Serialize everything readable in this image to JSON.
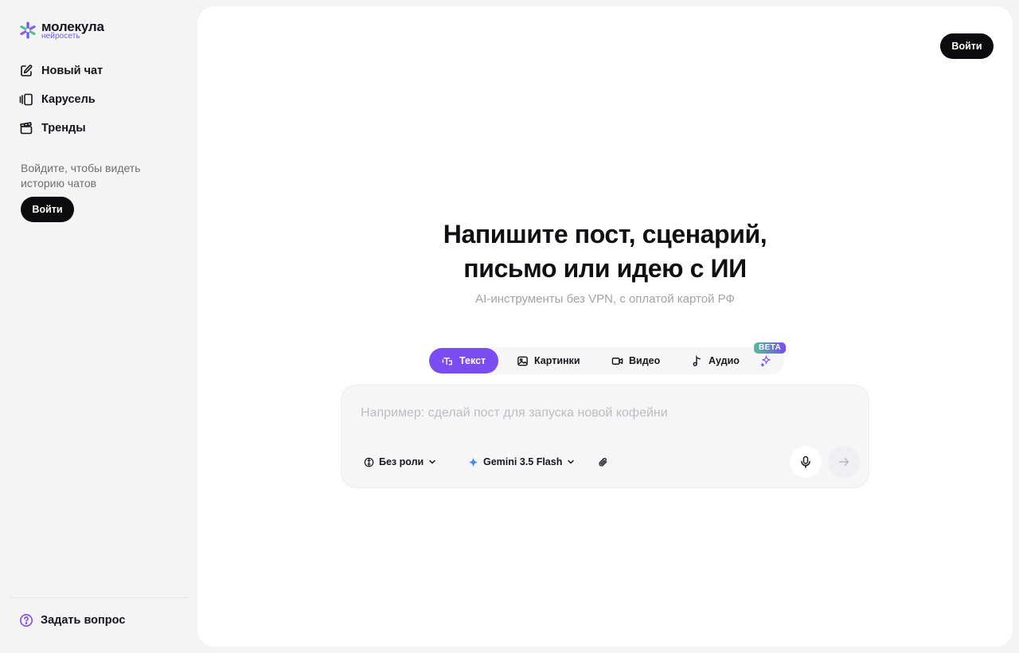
{
  "brand": {
    "name": "молекула",
    "sub": "нейросеть",
    "accent": "#7b4cf2"
  },
  "sidebar": {
    "items": [
      {
        "label": "Новый чат",
        "icon": "edit-icon"
      },
      {
        "label": "Карусель",
        "icon": "carousel-icon"
      },
      {
        "label": "Тренды",
        "icon": "clapperboard-icon"
      }
    ],
    "login_hint": "Войдите, чтобы видеть историю чатов",
    "login_label": "Войти",
    "help_label": "Задать вопрос"
  },
  "header": {
    "login_label": "Войти"
  },
  "hero": {
    "title_line1": "Напишите пост, сценарий,",
    "title_line2": "письмо или идею с ИИ",
    "subtitle": "AI-инструменты без VPN, с оплатой картой РФ"
  },
  "tabs": [
    {
      "label": "Текст",
      "icon": "text-icon",
      "active": true
    },
    {
      "label": "Картинки",
      "icon": "image-icon",
      "active": false
    },
    {
      "label": "Видео",
      "icon": "video-icon",
      "active": false
    },
    {
      "label": "Аудио",
      "icon": "music-note-icon",
      "active": false
    }
  ],
  "beta_badge": "BETA",
  "composer": {
    "placeholder": "Например: сделай пост для запуска новой кофейни",
    "value": "",
    "role_label": "Без роли",
    "model_label": "Gemini 3.5 Flash"
  }
}
